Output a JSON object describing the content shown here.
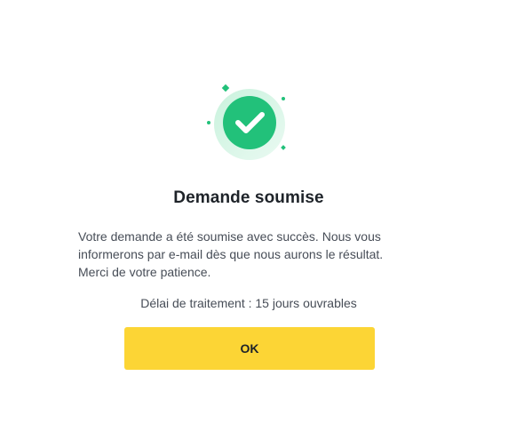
{
  "dialog": {
    "title": "Demande soumise",
    "message": "Votre demande a été soumise avec succès. Nous vous informerons par e-mail dès que nous aurons le résultat. Merci de votre patience.",
    "delay_text": "Délai de traitement : 15 jours ouvrables",
    "ok_label": "OK",
    "icon": "success-check-icon"
  },
  "colors": {
    "accent_green": "#22c17a",
    "button_yellow": "#fcd535",
    "text_primary": "#1e2329",
    "text_secondary": "#474d57"
  }
}
